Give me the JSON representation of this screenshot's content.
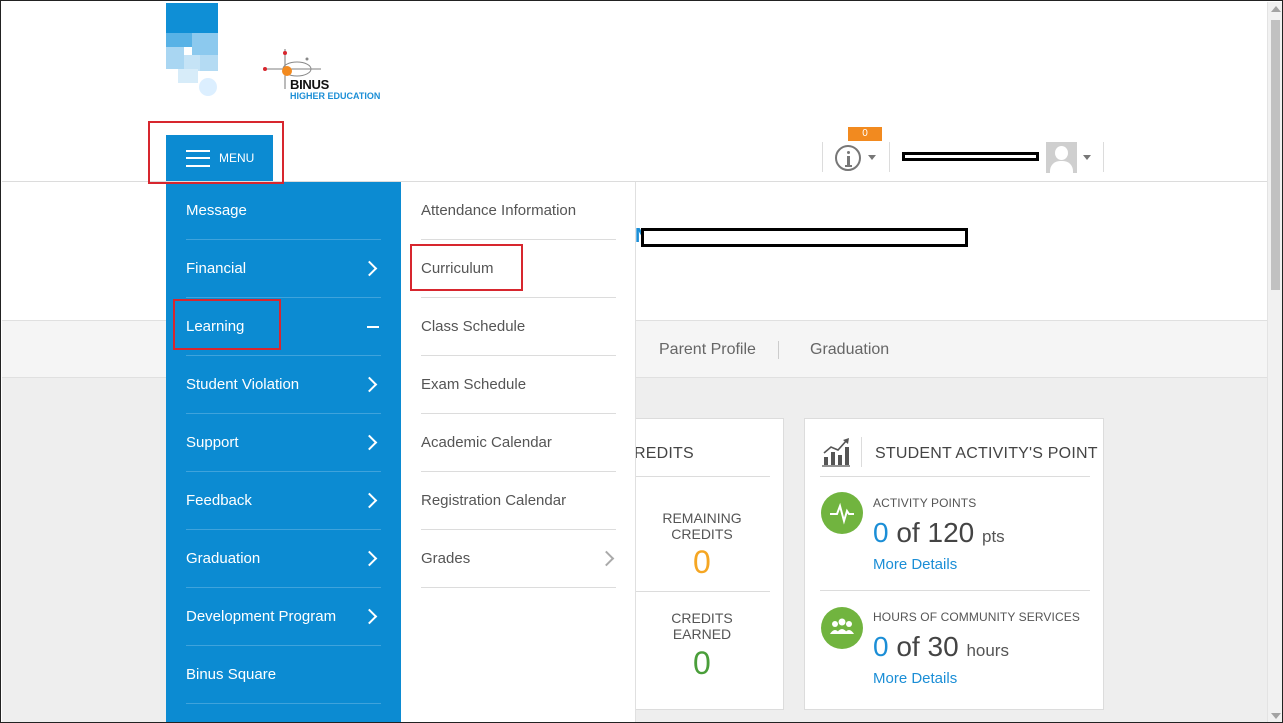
{
  "brand": {
    "name": "BINUS",
    "subtitle": "HIGHER EDUCATION"
  },
  "header": {
    "menu_label": "MENU",
    "notification_count": "0"
  },
  "colors": {
    "primary": "#0c8bd2",
    "accent_orange": "#f28a1f",
    "accent_green": "#71b43f",
    "highlight_red": "#d7262e",
    "credits_orange": "#f5a623",
    "credits_green": "#4a9e3a"
  },
  "menu": {
    "items": [
      {
        "label": "Message",
        "icon": "none"
      },
      {
        "label": "Financial",
        "icon": "chevron-right-icon"
      },
      {
        "label": "Learning",
        "icon": "minus-icon"
      },
      {
        "label": "Student Violation",
        "icon": "chevron-right-icon"
      },
      {
        "label": "Support",
        "icon": "chevron-right-icon"
      },
      {
        "label": "Feedback",
        "icon": "chevron-right-icon"
      },
      {
        "label": "Graduation",
        "icon": "chevron-right-icon"
      },
      {
        "label": "Development Program",
        "icon": "chevron-right-icon"
      },
      {
        "label": "Binus Square",
        "icon": "none"
      }
    ]
  },
  "submenu": {
    "items": [
      {
        "label": "Attendance Information"
      },
      {
        "label": "Curriculum"
      },
      {
        "label": "Class Schedule"
      },
      {
        "label": "Exam Schedule"
      },
      {
        "label": "Academic Calendar"
      },
      {
        "label": "Registration Calendar"
      },
      {
        "label": "Grades",
        "icon": "chevron-right-icon"
      }
    ]
  },
  "page": {
    "title_fragment": "N"
  },
  "tabs": [
    {
      "label": "Parent Profile"
    },
    {
      "label": "Graduation"
    }
  ],
  "credits_card": {
    "title_fragment": "REDITS",
    "remaining_label_line1": "REMAINING",
    "remaining_label_line2": "CREDITS",
    "remaining_value": "0",
    "earned_label_line1": "CREDITS",
    "earned_label_line2": "EARNED",
    "earned_value": "0"
  },
  "activity_card": {
    "title": "STUDENT ACTIVITY'S POINT",
    "activity_points": {
      "label": "ACTIVITY POINTS",
      "current": "0",
      "of": "of",
      "total": "120",
      "unit": "pts",
      "link": "More Details"
    },
    "community": {
      "label": "HOURS OF COMMUNITY SERVICES",
      "current": "0",
      "of": "of",
      "total": "30",
      "unit": "hours",
      "link": "More Details"
    }
  }
}
